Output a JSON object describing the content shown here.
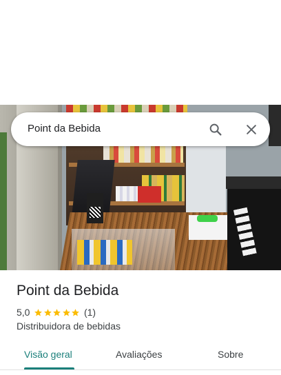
{
  "search": {
    "query": "Point da Bebida",
    "search_icon": "search-icon",
    "close_icon": "close-icon"
  },
  "place": {
    "name": "Point da Bebida",
    "rating": "5,0",
    "rating_stars": 5,
    "review_count": "(1)",
    "category": "Distribuidora de bebidas"
  },
  "tabs": [
    {
      "label": "Visão geral",
      "active": true
    },
    {
      "label": "Avaliações",
      "active": false
    },
    {
      "label": "Sobre",
      "active": false
    }
  ],
  "colors": {
    "accent": "#1a7f7a",
    "star": "#fbbc04",
    "text": "#202124",
    "secondary_text": "#3c4043"
  }
}
